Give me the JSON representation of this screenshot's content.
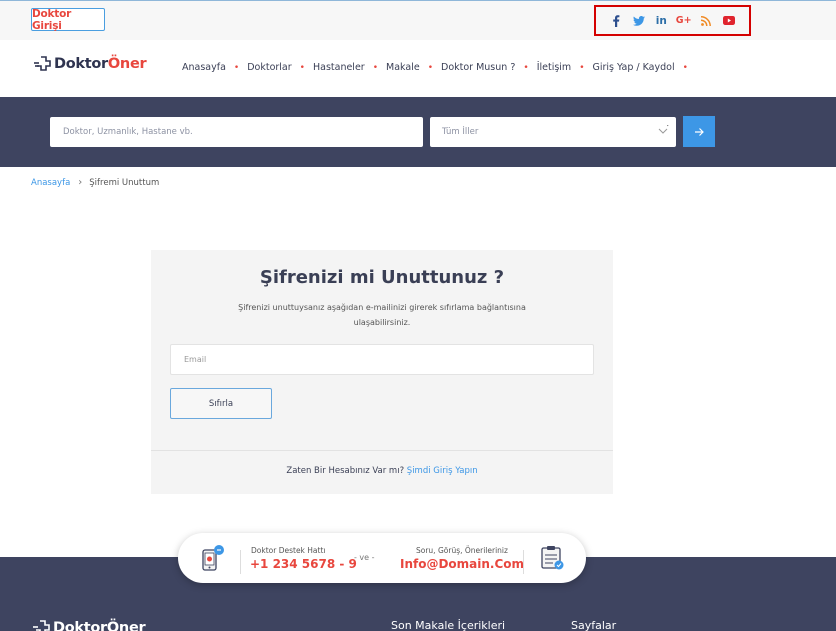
{
  "topbar": {
    "doctor_login": "Doktor Girişi",
    "social_icons": [
      {
        "name": "facebook-icon",
        "glyph": "f",
        "color": "#2d4f8e"
      },
      {
        "name": "twitter-icon",
        "glyph": "t",
        "color": "#3d97e6"
      },
      {
        "name": "linkedin-icon",
        "glyph": "in",
        "color": "#2d6fa8"
      },
      {
        "name": "google-plus-icon",
        "glyph": "G+",
        "color": "#e8473e"
      },
      {
        "name": "rss-icon",
        "glyph": "rss",
        "color": "#f08a24"
      },
      {
        "name": "youtube-icon",
        "glyph": "yt",
        "color": "#e0242e"
      }
    ]
  },
  "header": {
    "logo_main": "Doktor",
    "logo_accent": "Öner",
    "nav": [
      "Anasayfa",
      "Doktorlar",
      "Hastaneler",
      "Makale",
      "Doktor Musun ?",
      "İletişim",
      "Giriş Yap / Kaydol"
    ]
  },
  "search": {
    "placeholder": "Doktor, Uzmanlık, Hastane vb.",
    "city_selected": "Tüm İller"
  },
  "breadcrumb": {
    "home": "Anasayfa",
    "current": "Şifremi Unuttum"
  },
  "card": {
    "title": "Şifrenizi mi Unuttunuz ?",
    "description": "Şifrenizi unuttuysanız aşağıdan e-mailinizi girerek sıfırlama bağlantısına ulaşabilirsiniz.",
    "email_placeholder": "Email",
    "reset_button": "Sıfırla",
    "footer_text": "Zaten Bir Hesabınız Var mı?",
    "footer_link": "Şimdi Giriş Yapın"
  },
  "contact_pill": {
    "support_label": "Doktor Destek Hattı",
    "support_phone": "+1 234 5678 - 9",
    "separator": "- ve -",
    "contact_label": "Soru, Görüş, Önerileriniz",
    "contact_email": "Info@Domain.Com"
  },
  "footer": {
    "logo_main": "Doktor",
    "logo_accent": "Öner",
    "col_articles": "Son Makale İçerikleri",
    "col_pages": "Sayfalar"
  },
  "colors": {
    "accent_red": "#e8473e",
    "accent_blue": "#3d97e6",
    "navy": "#3e4460"
  }
}
